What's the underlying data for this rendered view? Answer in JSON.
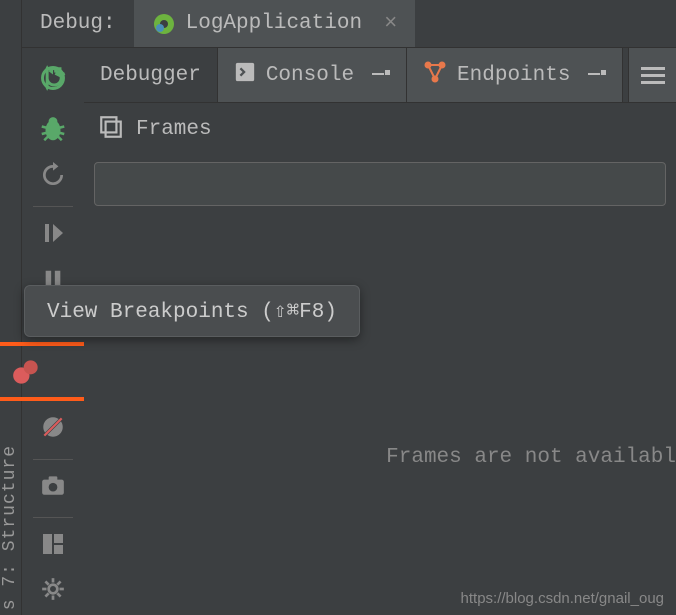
{
  "sidebar": {
    "structure_label": "s 7: Structure"
  },
  "header": {
    "debug_label": "Debug:",
    "run_tab": {
      "label": "LogApplication"
    }
  },
  "subtabs": {
    "debugger": "Debugger",
    "console": "Console",
    "endpoints": "Endpoints"
  },
  "frames": {
    "title": "Frames",
    "empty_message": "Frames are not availabl"
  },
  "tooltip": {
    "text": "View Breakpoints (⇧⌘F8)"
  },
  "watermark": "https://blog.csdn.net/gnail_oug"
}
